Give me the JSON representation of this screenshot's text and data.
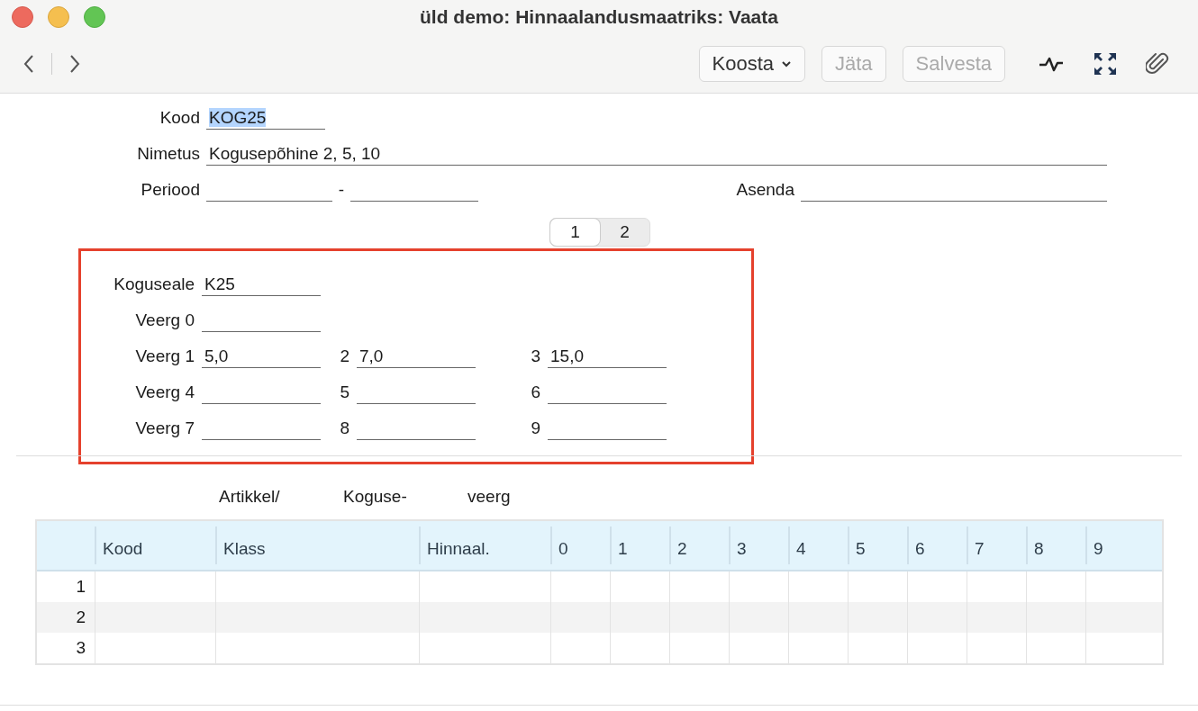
{
  "window": {
    "title": "üld demo: Hinnaalandusmaatriks: Vaata"
  },
  "toolbar": {
    "menu_button": {
      "label": "Koosta",
      "disabled": false
    },
    "buttons": [
      {
        "label": "Jäta",
        "disabled": true
      },
      {
        "label": "Salvesta",
        "disabled": true
      }
    ]
  },
  "header_fields": [
    {
      "label": "Kood",
      "value": "KOG25",
      "text_selected": true
    },
    {
      "label": "Nimetus",
      "value": "Kogusepõhine 2, 5, 10",
      "text_selected": false
    }
  ],
  "period": {
    "label": "Periood",
    "separator": "-"
  },
  "replace": {
    "label": "Asenda"
  },
  "tabs": [
    {
      "label": "1",
      "selected": true
    },
    {
      "label": "2",
      "selected": false
    }
  ],
  "quantity_section": {
    "highlighted": true,
    "rows": [
      [
        {
          "label": "Koguseale",
          "value": "K25"
        }
      ],
      [
        {
          "label": "Veerg 0"
        }
      ],
      [
        {
          "label": "Veerg 1",
          "value": "5,0"
        },
        {
          "label": "2",
          "value": "7,0"
        },
        {
          "label": "3",
          "value": "15,0"
        }
      ],
      [
        {
          "label": "Veerg 4"
        },
        {
          "label": "5"
        },
        {
          "label": "6"
        }
      ],
      [
        {
          "label": "Veerg 7"
        },
        {
          "label": "8"
        },
        {
          "label": "9"
        }
      ]
    ]
  },
  "table": {
    "group_headers": [
      "Artikkel/",
      "Koguse-",
      "veerg"
    ],
    "columns": [
      "Kood",
      "Klass",
      "Hinnaal.",
      "0",
      "1",
      "2",
      "3",
      "4",
      "5",
      "6",
      "7",
      "8",
      "9"
    ],
    "rows": [
      {
        "number": "1"
      },
      {
        "number": "2"
      },
      {
        "number": "3"
      }
    ]
  }
}
